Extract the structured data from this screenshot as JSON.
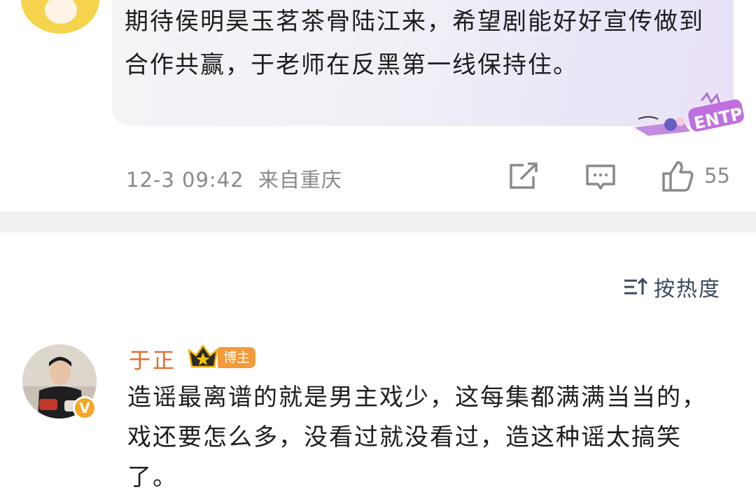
{
  "comment1": {
    "text": "期待侯明昊玉茗茶骨陆江来，希望剧能好好宣传做到合作共赢，于老师在反黑第一线保持住。",
    "badge_text": "ENTP",
    "timestamp": "12-3 09:42",
    "location": "来自重庆",
    "like_count": "55"
  },
  "sort": {
    "label": "按热度"
  },
  "comment2": {
    "username": "于正",
    "role_badge": "博主",
    "verified_mark": "V",
    "text": "造谣最离谱的就是男主戏少，这每集都满满当当的，戏还要怎么多，没看过就没看过，造这种谣太搞笑了。"
  },
  "colors": {
    "username": "#e8692a",
    "role_badge": "#f39a3a",
    "meta_gray": "#8a8a8a",
    "divider": "#f0f0f0"
  }
}
